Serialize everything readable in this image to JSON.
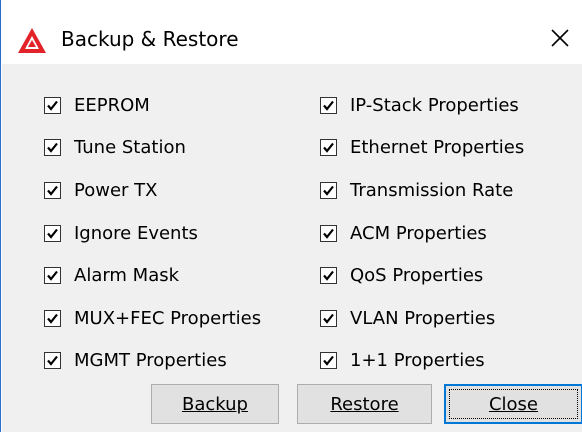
{
  "window": {
    "title": "Backup & Restore"
  },
  "checkboxes": {
    "left": [
      {
        "label": "EEPROM",
        "checked": true
      },
      {
        "label": "Tune Station",
        "checked": true
      },
      {
        "label": "Power TX",
        "checked": true
      },
      {
        "label": "Ignore Events",
        "checked": true
      },
      {
        "label": "Alarm Mask",
        "checked": true
      },
      {
        "label": "MUX+FEC Properties",
        "checked": true
      },
      {
        "label": "MGMT Properties",
        "checked": true
      }
    ],
    "right": [
      {
        "label": "IP-Stack Properties",
        "checked": true
      },
      {
        "label": "Ethernet Properties",
        "checked": true
      },
      {
        "label": "Transmission Rate",
        "checked": true
      },
      {
        "label": "ACM Properties",
        "checked": true
      },
      {
        "label": "QoS Properties",
        "checked": true
      },
      {
        "label": "VLAN Properties",
        "checked": true
      },
      {
        "label": "1+1 Properties",
        "checked": true
      }
    ]
  },
  "buttons": {
    "backup": "Backup",
    "restore": "Restore",
    "close": "Close"
  },
  "colors": {
    "icon_red": "#e3232a",
    "focus_blue": "#0078d7"
  },
  "icons": {
    "app": "warning-triangle-icon",
    "close": "close-icon",
    "check": "checkmark-icon"
  }
}
